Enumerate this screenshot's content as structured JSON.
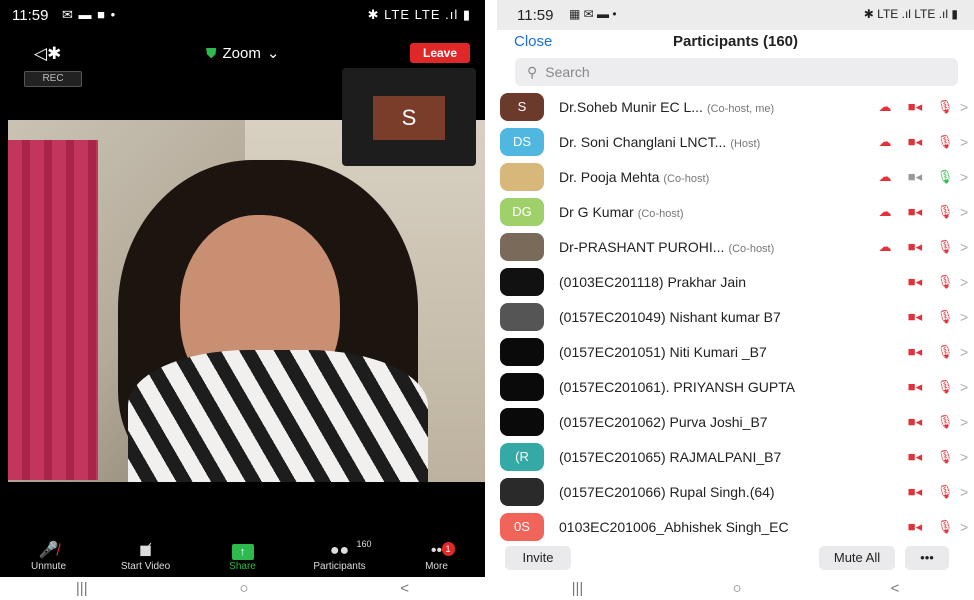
{
  "left": {
    "status": {
      "time": "11:59",
      "icons": "✉ ▬ ■ •",
      "right_icons": "✱ LTE LTE .ıl ▮"
    },
    "title": "Zoom",
    "leave_label": "Leave",
    "rec_label": "REC",
    "pip_initial": "S",
    "toolbar": [
      {
        "label": "Unmute",
        "icon": "mic-off-icon",
        "glyph": "🎤"
      },
      {
        "label": "Start Video",
        "icon": "video-off-icon",
        "glyph": "▶"
      },
      {
        "label": "Share",
        "icon": "share-icon",
        "glyph": "↑"
      },
      {
        "label": "Participants",
        "icon": "participants-icon",
        "glyph": "👥"
      },
      {
        "label": "More",
        "icon": "more-icon",
        "glyph": "•••"
      }
    ],
    "participants_count": "160",
    "more_badge": "1",
    "nav": [
      "|||",
      "○",
      "<"
    ]
  },
  "right": {
    "status": {
      "time": "11:59",
      "icons": "▦ ✉ ▬ •",
      "right_icons": "✱ LTE .ıl LTE .ıl ▮"
    },
    "close_label": "Close",
    "title": "Participants (160)",
    "search_placeholder": "Search",
    "participants": [
      {
        "initials": "S",
        "color": "#6b3a2b",
        "name": "Dr.Soheb Munir EC L...",
        "role": "(Co-host, me)",
        "cloud": true,
        "video": "off",
        "mic": "off"
      },
      {
        "initials": "DS",
        "color": "#4fb7e0",
        "name": "Dr. Soni Changlani LNCT...",
        "role": "(Host)",
        "cloud": true,
        "video": "off",
        "mic": "off"
      },
      {
        "initials": "",
        "color": "#d7b87a",
        "name": "Dr. Pooja Mehta",
        "role": "(Co-host)",
        "cloud": true,
        "video": "gray",
        "mic": "on"
      },
      {
        "initials": "DG",
        "color": "#9fd06a",
        "name": "Dr G Kumar",
        "role": "(Co-host)",
        "cloud": true,
        "video": "off",
        "mic": "off"
      },
      {
        "initials": "",
        "color": "#7a6a5a",
        "name": "Dr-PRASHANT PUROHI...",
        "role": "(Co-host)",
        "cloud": true,
        "video": "off",
        "mic": "off"
      },
      {
        "initials": "",
        "color": "#111111",
        "name": "(0103EC201118) Prakhar Jain",
        "role": "",
        "cloud": false,
        "video": "off",
        "mic": "off"
      },
      {
        "initials": "",
        "color": "#555555",
        "name": "(0157EC201049) Nishant kumar B7",
        "role": "",
        "cloud": false,
        "video": "off",
        "mic": "off"
      },
      {
        "initials": "",
        "color": "#0a0a0a",
        "name": "(0157EC201051) Niti Kumari _B7",
        "role": "",
        "cloud": false,
        "video": "off",
        "mic": "off"
      },
      {
        "initials": "",
        "color": "#0a0a0a",
        "name": "(0157EC201061). PRIYANSH GUPTA",
        "role": "",
        "cloud": false,
        "video": "off",
        "mic": "off"
      },
      {
        "initials": "",
        "color": "#0a0a0a",
        "name": "(0157EC201062) Purva Joshi_B7",
        "role": "",
        "cloud": false,
        "video": "off",
        "mic": "off"
      },
      {
        "initials": "(R",
        "color": "#35a9a6",
        "name": "(0157EC201065) RAJMALPANI_B7",
        "role": "",
        "cloud": false,
        "video": "off",
        "mic": "off"
      },
      {
        "initials": "",
        "color": "#2a2a2a",
        "name": "(0157EC201066) Rupal Singh.(64)",
        "role": "",
        "cloud": false,
        "video": "off",
        "mic": "off"
      },
      {
        "initials": "0S",
        "color": "#f0645a",
        "name": "0103EC201006_Abhishek Singh_EC",
        "role": "",
        "cloud": false,
        "video": "off",
        "mic": "off"
      }
    ],
    "invite_label": "Invite",
    "mute_all_label": "Mute All",
    "more_label": "•••",
    "nav": [
      "|||",
      "○",
      "<"
    ]
  }
}
